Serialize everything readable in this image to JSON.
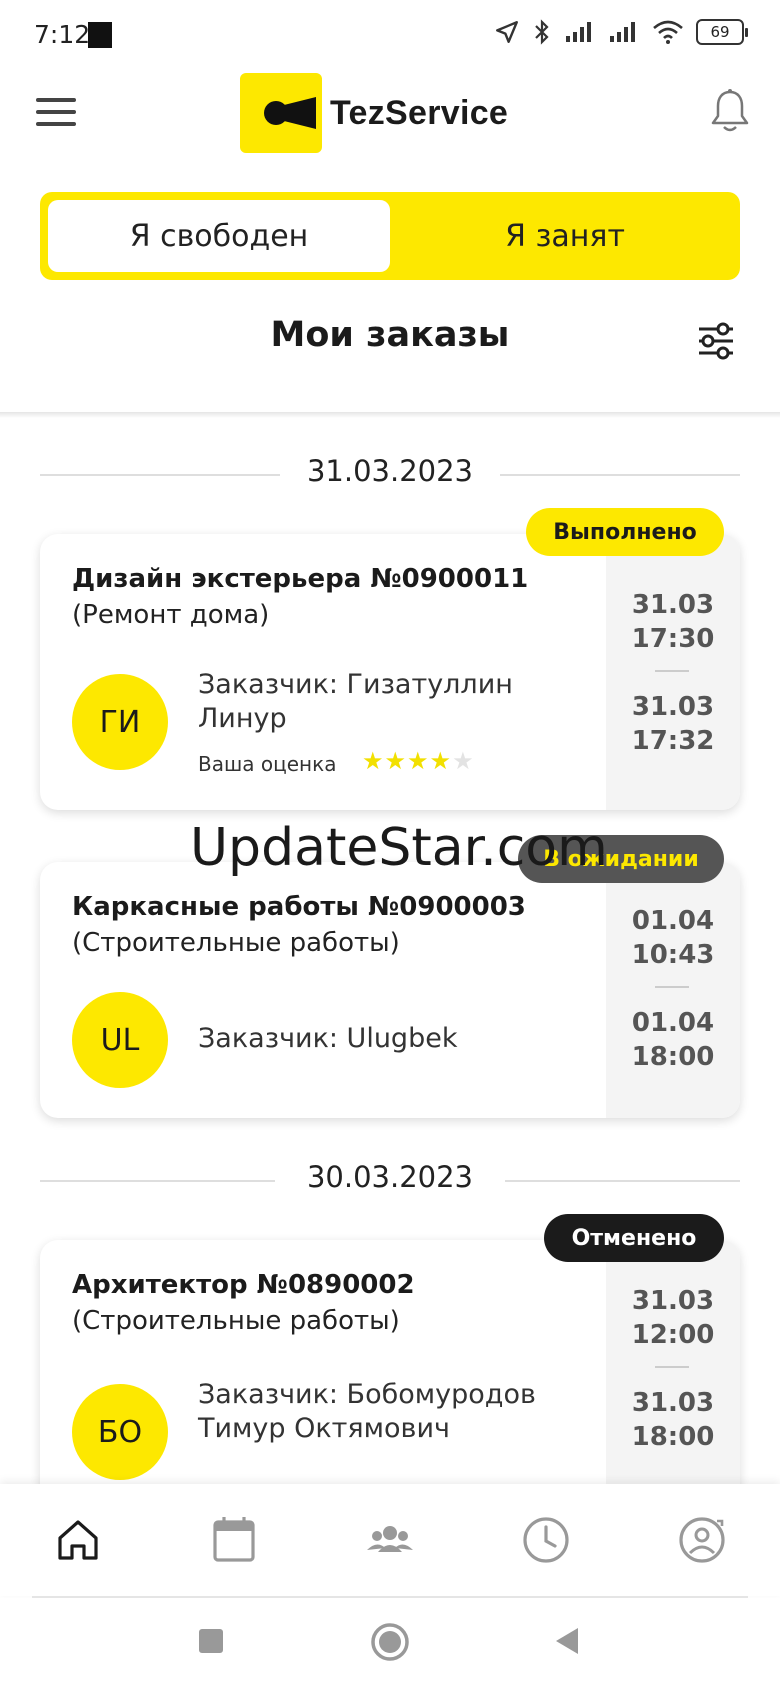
{
  "status_bar": {
    "time": "7:12",
    "battery": "69"
  },
  "app": {
    "name": "TezService"
  },
  "toggle": {
    "free_label": "Я свободен",
    "busy_label": "Я занят"
  },
  "header": {
    "title": "Мои заказы"
  },
  "colors": {
    "accent": "#fde800",
    "waiting_badge": "#555555",
    "cancelled_badge": "#1b1b1b"
  },
  "groups": [
    {
      "date": "31.03.2023"
    },
    {
      "date": "30.03.2023"
    }
  ],
  "orders": [
    {
      "status": "Выполнено",
      "title": "Дизайн экстерьера №0900011",
      "category": "(Ремонт дома)",
      "initials": "ГИ",
      "customer": "Заказчик: Гизатуллин Линур",
      "rating_label": "Ваша оценка",
      "rating": 4,
      "rating_max": 5,
      "start_date": "31.03",
      "start_time": "17:30",
      "end_date": "31.03",
      "end_time": "17:32"
    },
    {
      "status": "В ожидании",
      "title": "Каркасные работы №0900003",
      "category": "(Строительные работы)",
      "initials": "UL",
      "customer": "Заказчик: Ulugbek",
      "start_date": "01.04",
      "start_time": "10:43",
      "end_date": "01.04",
      "end_time": "18:00"
    },
    {
      "status": "Отменено",
      "title": "Архитектор №0890002",
      "category": "(Строительные работы)",
      "initials": "БО",
      "customer": "Заказчик: Бобомуродов Тимур Октямович",
      "start_date": "31.03",
      "start_time": "12:00",
      "end_date": "31.03",
      "end_time": "18:00"
    }
  ],
  "watermark": "UpdateStar.com",
  "nav": [
    {
      "icon": "home-icon"
    },
    {
      "icon": "calendar-icon"
    },
    {
      "icon": "group-icon"
    },
    {
      "icon": "history-icon"
    },
    {
      "icon": "profile-icon"
    }
  ]
}
